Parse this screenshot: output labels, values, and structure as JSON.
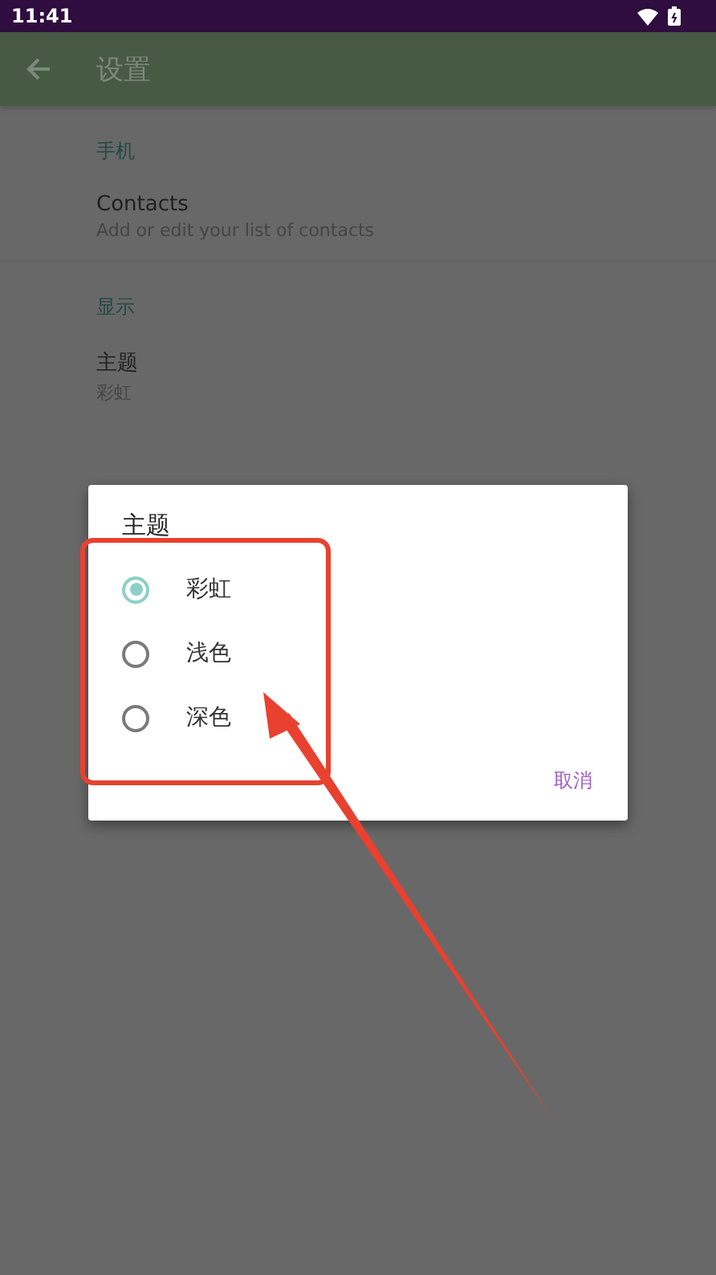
{
  "status_bar": {
    "time": "11:41"
  },
  "app_bar": {
    "title": "设置"
  },
  "sections": [
    {
      "header": "手机",
      "items": [
        {
          "title": "Contacts",
          "summary": "Add or edit your list of contacts"
        }
      ]
    },
    {
      "header": "显示",
      "items": [
        {
          "title": "主题",
          "summary": "彩虹"
        }
      ]
    }
  ],
  "dialog": {
    "title": "主题",
    "options": [
      {
        "label": "彩虹",
        "selected": true
      },
      {
        "label": "浅色",
        "selected": false
      },
      {
        "label": "深色",
        "selected": false
      }
    ],
    "cancel": "取消"
  }
}
